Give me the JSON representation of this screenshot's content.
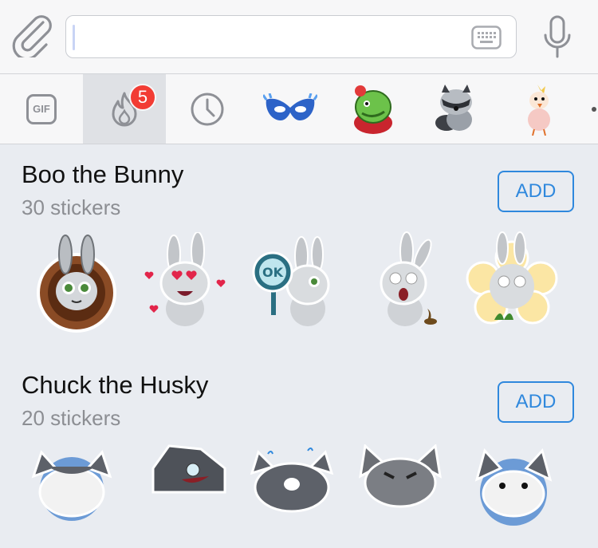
{
  "input_bar": {
    "attach_icon": "paperclip-icon",
    "message_value": "",
    "keyboard_icon": "keyboard-icon",
    "mic_icon": "microphone-icon"
  },
  "tabs": {
    "gif_label": "GIF",
    "trending_badge": "5",
    "items": [
      "gif",
      "trending-fire-icon",
      "recent-clock-icon",
      "blue-mask-sticker",
      "green-monster-sticker",
      "raccoon-sticker",
      "cockatoo-sticker"
    ]
  },
  "packs": [
    {
      "title": "Boo the Bunny",
      "count": "30 stickers",
      "add_label": "ADD"
    },
    {
      "title": "Chuck the Husky",
      "count": "20 stickers",
      "add_label": "ADD"
    }
  ],
  "colors": {
    "accent": "#2f88dd",
    "badge": "#f23c34",
    "background": "#e9ecf1"
  }
}
